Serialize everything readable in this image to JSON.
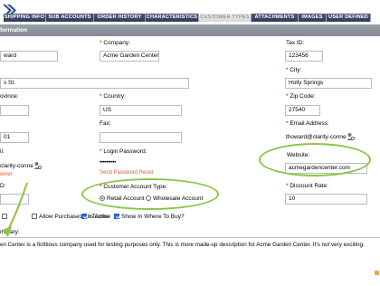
{
  "tabs": [
    {
      "label": "SHIPPING INFO",
      "active": false
    },
    {
      "label": "SUB ACCOUNTS",
      "active": false
    },
    {
      "label": "ORDER HISTORY",
      "active": false
    },
    {
      "label": "CHARACTERISTICS",
      "active": false
    },
    {
      "label": "CUSTOMER TYPES",
      "active": true
    },
    {
      "label": "ATTACHMENTS",
      "active": false
    },
    {
      "label": "IMAGES",
      "active": false
    },
    {
      "label": "USER DEFINED",
      "active": false
    }
  ],
  "section_title": "formation",
  "fields": {
    "first_name_value": "ward",
    "company_label": "Company:",
    "company_value": "Acme Garden Center",
    "tax_id_label": "Tax ID:",
    "tax_id_value": "123456",
    "address_value": "s St.",
    "city_label": "City:",
    "city_value": "Holly Springs",
    "province_label": "ovince:",
    "country_label": "Country:",
    "country_value": "US",
    "zip_label": "Zip Code:",
    "zip_value": "27540",
    "phone_value": "01",
    "fax_label": "Fax:",
    "email_label": "Email Address:",
    "email_value": "thoward@clarity-conne",
    "login_email_label": "il:",
    "login_email_value": "clarity-conne",
    "login_password_label": "Login Password:",
    "password_value": "••••••••••",
    "website_label": "Website:",
    "website_value": "acmegardencenter.com",
    "customer_link": "omer",
    "send_password_reset": "Send Password Reset",
    "partial_label": "D:",
    "customer_account_type_label": "Customer Account Type:",
    "retail_label": "Retail Account",
    "wholesale_label": "Wholesale Account",
    "discount_label": "Discount Rate:",
    "discount_value": "10",
    "allow_purchases_label": "Allow Purchases on Terms",
    "is_active_label": "Is Active",
    "show_in_where_label": "Show In Where To Buy?",
    "summary_label": "mmary:",
    "summary_text": "en Center is a fictitious company used for testing purposes only.  This is more made-up description for Acme Garden Center. It's not very exciting."
  },
  "colors": {
    "tab_bg": "#3b4566",
    "section_bg": "#8f959d",
    "required": "#e05a1e",
    "link": "#e2612b",
    "annotation": "#8ec448",
    "accent_blue": "#1e5bd8"
  },
  "icons": {
    "nav": "double-chevron-right-icon",
    "email_verify": "user-gear-icon"
  }
}
